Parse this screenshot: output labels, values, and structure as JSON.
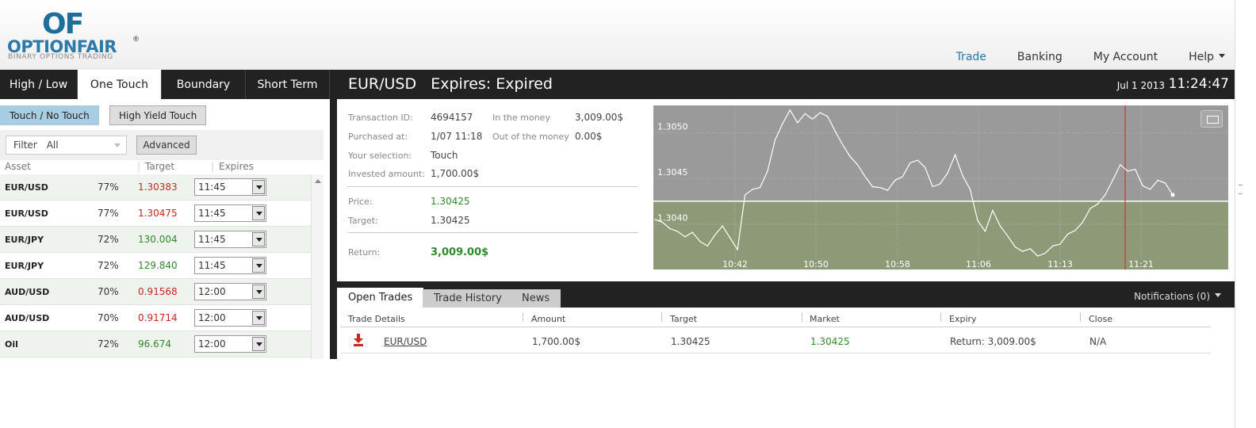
{
  "logo": {
    "mark": "OF",
    "name": "OPTIONFAIR",
    "reg": "®",
    "tagline": "BINARY OPTIONS TRADING"
  },
  "topnav": [
    {
      "label": "Trade"
    },
    {
      "label": "Banking"
    },
    {
      "label": "My Account"
    },
    {
      "label": "Help"
    }
  ],
  "left": {
    "tabs": [
      {
        "label": "High / Low"
      },
      {
        "label": "One Touch"
      },
      {
        "label": "Boundary"
      },
      {
        "label": "Short Term"
      }
    ],
    "subtabs": [
      {
        "label": "Touch / No Touch"
      },
      {
        "label": "High Yield Touch"
      }
    ],
    "filter": {
      "label": "Filter",
      "value": "All"
    },
    "advanced_label": "Advanced",
    "columns": {
      "asset": "Asset",
      "target": "Target",
      "expires": "Expires"
    },
    "assets": [
      {
        "name": "EUR/USD",
        "pct": "77%",
        "target": "1.30383",
        "expires": "11:45"
      },
      {
        "name": "EUR/USD",
        "pct": "77%",
        "target": "1.30475",
        "expires": "11:45"
      },
      {
        "name": "EUR/JPY",
        "pct": "72%",
        "target": "130.004",
        "expires": "11:45"
      },
      {
        "name": "EUR/JPY",
        "pct": "72%",
        "target": "129.840",
        "expires": "11:45"
      },
      {
        "name": "AUD/USD",
        "pct": "70%",
        "target": "0.91568",
        "expires": "12:00"
      },
      {
        "name": "AUD/USD",
        "pct": "70%",
        "target": "0.91714",
        "expires": "12:00"
      },
      {
        "name": "Oil",
        "pct": "72%",
        "target": "96.674",
        "expires": "12:00"
      }
    ]
  },
  "right": {
    "title": "EUR/USD   Expires: Expired",
    "date": "Jul 1 2013",
    "time": "11:24:47",
    "details": {
      "transaction_id_label": "Transaction ID:",
      "transaction_id": "4694157",
      "purchased_label": "Purchased at:",
      "purchased": "1/07 11:18",
      "selection_label": "Your selection:",
      "selection": "Touch",
      "invested_label": "Invested amount:",
      "invested": "1,700.00$",
      "in_money_label": "In the money",
      "in_money": "3,009.00$",
      "out_money_label": "Out of the money",
      "out_money": "0.00$",
      "price_label": "Price:",
      "price": "1.30425",
      "target_label": "Target:",
      "target": "1.30425",
      "return_label": "Return:",
      "return": "3,009.00$"
    },
    "bottom_tabs": [
      {
        "label": "Open Trades"
      },
      {
        "label": "Trade History"
      },
      {
        "label": "News"
      }
    ],
    "notifications": "Notifications (0)",
    "trades_columns": {
      "details": "Trade Details",
      "amount": "Amount",
      "target": "Target",
      "market": "Market",
      "expiry": "Expiry",
      "close": "Close"
    },
    "trade_row": {
      "asset": "EUR/USD",
      "amount": "1,700.00$",
      "target": "1.30425",
      "market": "1.30425",
      "expiry": "Return: 3,009.00$",
      "close": "N/A"
    }
  },
  "chart_data": {
    "type": "line",
    "title": "",
    "x_ticks": [
      "10:42",
      "10:50",
      "10:58",
      "11:06",
      "11:13",
      "11:21"
    ],
    "y_ticks": [
      "1.3050",
      "1.3045",
      "1.3040"
    ],
    "target_level": 1.30425,
    "expiry_marker_time": "11:18",
    "series": [
      {
        "values": [
          1.30405,
          1.30402,
          1.30395,
          1.30392,
          1.30386,
          1.30391,
          1.30381,
          1.30376,
          1.30388,
          1.30398,
          1.30385,
          1.30372,
          1.30432,
          1.30438,
          1.3044,
          1.30458,
          1.30492,
          1.3051,
          1.30525,
          1.30511,
          1.30521,
          1.30515,
          1.30522,
          1.30518,
          1.30502,
          1.30487,
          1.30474,
          1.30465,
          1.30452,
          1.30441,
          1.3044,
          1.30437,
          1.30448,
          1.30452,
          1.30467,
          1.3047,
          1.30462,
          1.30441,
          1.30444,
          1.30456,
          1.30476,
          1.30453,
          1.30438,
          1.30404,
          1.30392,
          1.30415,
          1.30398,
          1.30387,
          1.30375,
          1.3037,
          1.30373,
          1.30365,
          1.30368,
          1.30376,
          1.30378,
          1.30389,
          1.30393,
          1.30402,
          1.30417,
          1.30422,
          1.30432,
          1.30448,
          1.30465,
          1.30458,
          1.3046,
          1.30442,
          1.30438,
          1.30448,
          1.30445,
          1.30432
        ],
        "color": "#ffffff"
      }
    ],
    "colors": {
      "background": "#9a9a9a",
      "below_target": "#8e9a77",
      "marker": "#d22020"
    }
  }
}
